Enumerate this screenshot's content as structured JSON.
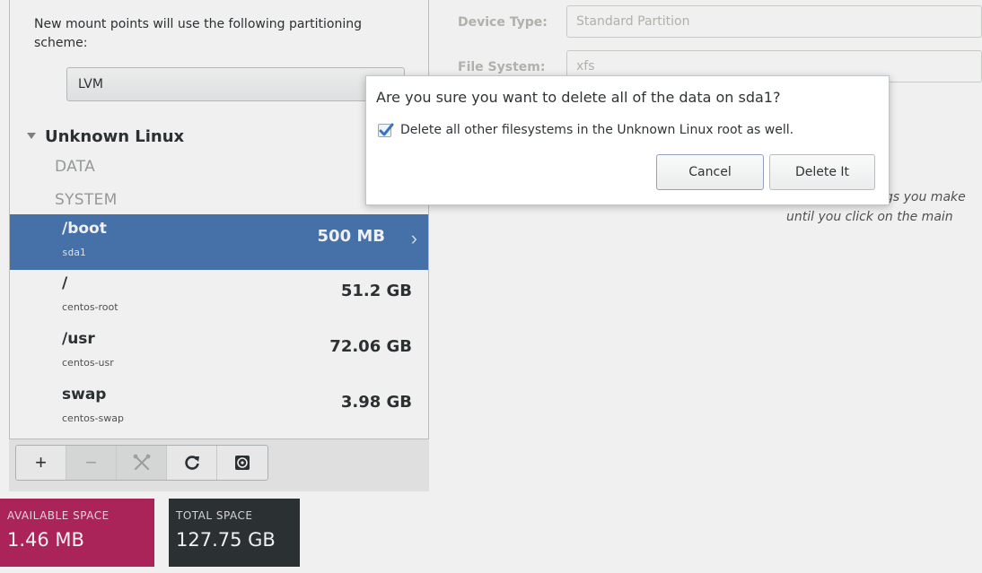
{
  "left": {
    "scheme_text": "New mount points will use the following partitioning scheme:",
    "scheme_value": "LVM",
    "os_name": "Unknown Linux",
    "groups": [
      "DATA",
      "SYSTEM"
    ],
    "mounts": [
      {
        "name": "/boot",
        "device": "sda1",
        "size": "500 MB",
        "selected": true
      },
      {
        "name": "/",
        "device": "centos-root",
        "size": "51.2 GB"
      },
      {
        "name": "/usr",
        "device": "centos-usr",
        "size": "72.06 GB"
      },
      {
        "name": "swap",
        "device": "centos-swap",
        "size": "3.98 GB"
      }
    ],
    "toolbar": {
      "add": "+",
      "remove": "−",
      "configure_icon": "tools-icon",
      "refresh_icon": "refresh-icon",
      "disk_icon": "disk-icon"
    },
    "available_label": "AVAILABLE SPACE",
    "available_value": "1.46 MB",
    "total_label": "TOTAL SPACE",
    "total_value": "127.75 GB"
  },
  "right": {
    "device_type_label": "Device Type:",
    "device_type_value": "Standard Partition",
    "file_system_label": "File System:",
    "file_system_value": "xfs",
    "hint_line1": "gs you make",
    "hint_line2": "until you click on the main"
  },
  "dialog": {
    "question": "Are you sure you want to delete all of the data on sda1?",
    "checkbox_label": "Delete all other filesystems in the Unknown Linux root as well.",
    "checkbox_checked": true,
    "cancel_label": "Cancel",
    "delete_label": "Delete It"
  },
  "colors": {
    "selection": "#4a77b3",
    "available": "#b5275f",
    "total": "#2e3436"
  }
}
